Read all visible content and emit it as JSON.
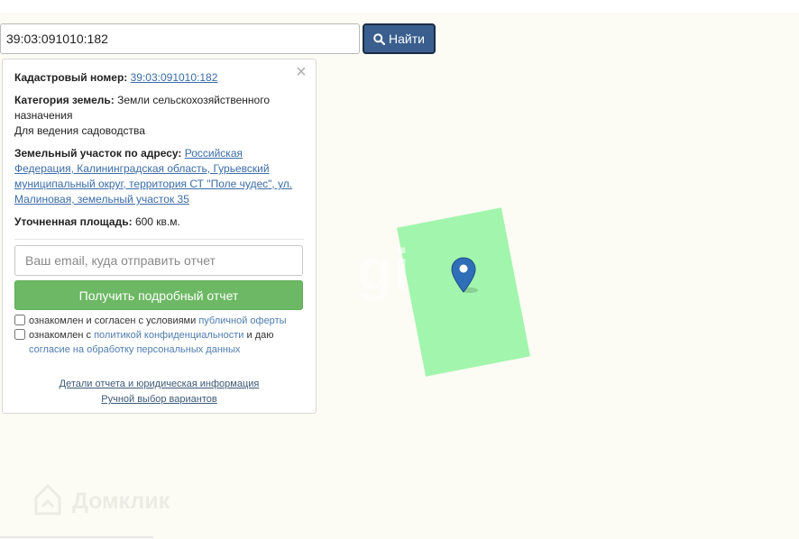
{
  "search": {
    "value": "39:03:091010:182",
    "button_label": "Найти",
    "button_icon": "search-icon"
  },
  "panel": {
    "close_icon": "close-icon",
    "cadastral_label": "Кадастровый номер:",
    "cadastral_value": "39:03:091010:182",
    "category_label": "Категория земель:",
    "category_value": "Земли сельскохозяйственного назначения",
    "usage": "Для ведения садоводства",
    "address_label": "Земельный участок по адресу:",
    "address_value": "Российская Федерация, Калининградская область, Гурьевский муниципальный округ, территория СТ \"Поле чудес\", ул. Малиновая, земельный участок 35",
    "area_label": "Уточненная площадь:",
    "area_value": "600 кв.м.",
    "email_placeholder": "Ваш email, куда отправить отчет",
    "report_button": "Получить подробный отчет",
    "consent1_text": "ознакомлен и согласен с условиями",
    "consent1_link": "публичной оферты",
    "consent2_text_a": "ознакомлен с",
    "consent2_link_a": "политикой конфиденциальности",
    "consent2_text_b": "и даю",
    "consent2_link_b": "согласие на обработку персональных данных",
    "details_link": "Детали отчета и юридическая информация",
    "manual_link": "Ручной выбор вариантов"
  },
  "map": {
    "parcel_color": "#a2f5ac",
    "marker_color": "#2f6fb8",
    "watermark": "gi",
    "brand": "Домклик"
  },
  "colors": {
    "accent": "#3a5f8e",
    "report_button": "#6cb864",
    "link": "#3a6ca8"
  }
}
